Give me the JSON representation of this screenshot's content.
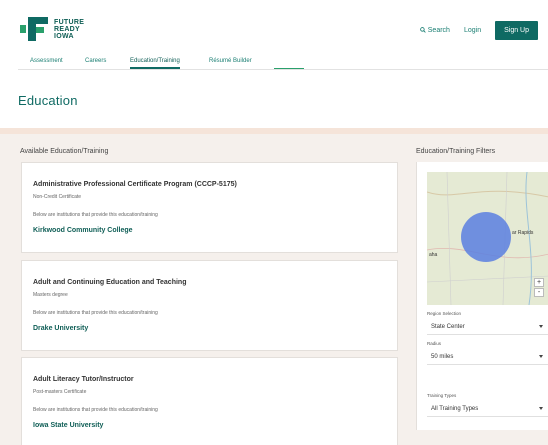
{
  "header": {
    "logo_lines": [
      "FUTURE",
      "READY",
      "IOWA"
    ],
    "search_label": "Search",
    "login_label": "Login",
    "signup_label": "Sign Up"
  },
  "tabs": [
    {
      "label": "Assessment"
    },
    {
      "label": "Careers"
    },
    {
      "label": "Education/Training"
    },
    {
      "label": "Résumé Builder"
    }
  ],
  "page_title": "Education",
  "available_heading": "Available Education/Training",
  "filters_heading": "Education/Training Filters",
  "cards": [
    {
      "title": "Administrative Professional Certificate Program (CCCP-5175)",
      "type": "Non-Credit Certificate",
      "note": "Below are institutions that provide this education/training",
      "institution": "Kirkwood Community College"
    },
    {
      "title": "Adult and Continuing Education and Teaching",
      "type": "Masters degree",
      "note": "Below are institutions that provide this education/training",
      "institution": "Drake University"
    },
    {
      "title": "Adult Literacy Tutor/Instructor",
      "type": "Post-masters Certificate",
      "note": "Below are institutions that provide this education/training",
      "institution": "Iowa State University"
    }
  ],
  "filters": {
    "map_labels": {
      "city": "ar Rapids",
      "side": "aha"
    },
    "zoom_in": "+",
    "zoom_out": "-",
    "region_label": "Region Selection",
    "region_value": "State Center",
    "radius_label": "Radius",
    "radius_value": "50 miles",
    "training_label": "Training Types",
    "training_value": "All Training Types"
  },
  "colors": {
    "brand": "#0f6a63",
    "accent": "#2aa06c",
    "band": "#f5e4d9",
    "background": "#f5f0ec"
  }
}
